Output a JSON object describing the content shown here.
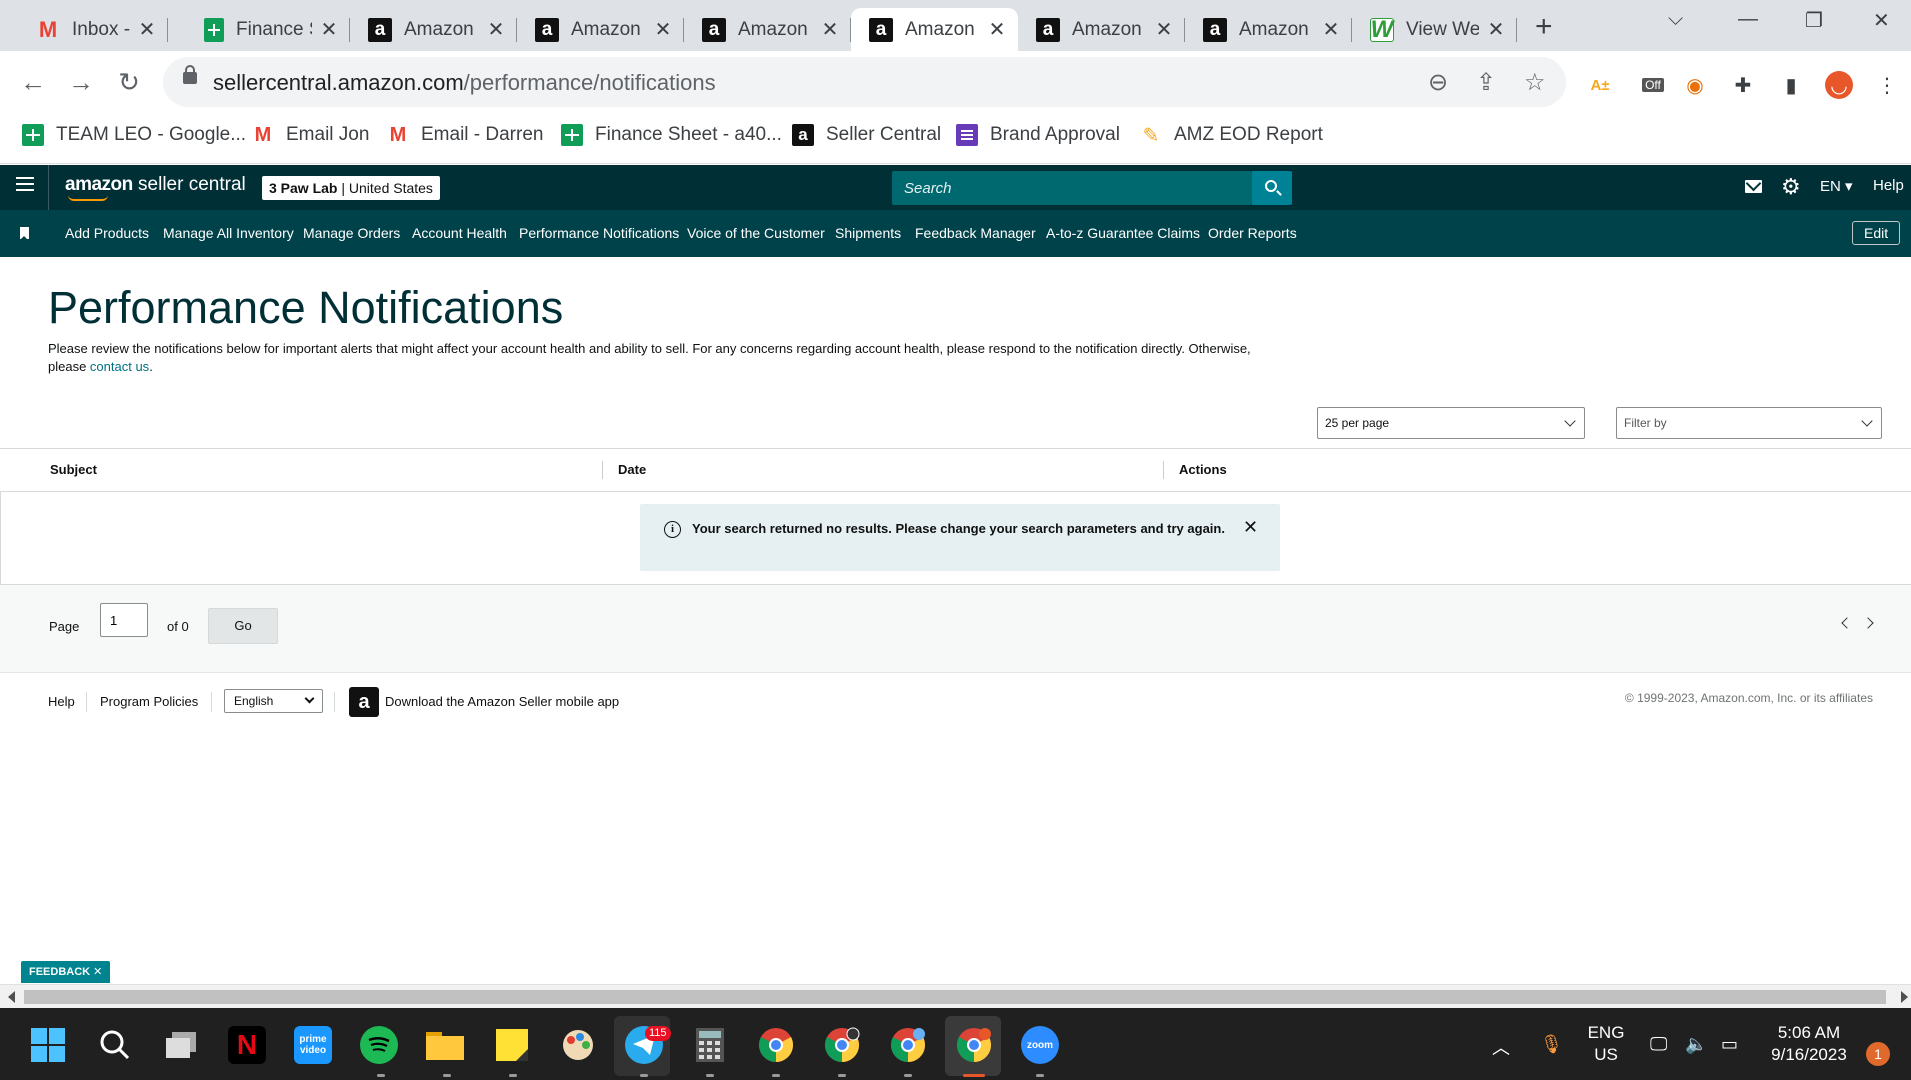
{
  "browser": {
    "tabs": [
      {
        "title": "Inbox - d",
        "favicon": "gmail-icon"
      },
      {
        "title": "Finance S",
        "favicon": "sheets-icon"
      },
      {
        "title": "Amazon",
        "favicon": "amazon-icon"
      },
      {
        "title": "Amazon",
        "favicon": "amazon-icon"
      },
      {
        "title": "Amazon",
        "favicon": "amazon-icon"
      },
      {
        "title": "Amazon",
        "favicon": "amazon-icon",
        "active": true
      },
      {
        "title": "Amazon",
        "favicon": "amazon-icon"
      },
      {
        "title": "Amazon",
        "favicon": "amazon-icon"
      },
      {
        "title": "View We",
        "favicon": "w-icon"
      }
    ],
    "close_glyph": "✕",
    "url_host": "sellercentral.amazon.com",
    "url_path": "/performance/notifications",
    "extensions": {
      "scout_label": "A±",
      "off_badge": "Off"
    },
    "bookmarks": [
      {
        "label": "TEAM LEO - Google...",
        "icon": "sheets-icon"
      },
      {
        "label": "Email Jon",
        "icon": "gmail-icon"
      },
      {
        "label": "Email - Darren",
        "icon": "gmail-icon"
      },
      {
        "label": "Finance Sheet - a40...",
        "icon": "sheets-icon"
      },
      {
        "label": "Seller Central",
        "icon": "amazon-icon"
      },
      {
        "label": "Brand Approval",
        "icon": "forms-icon"
      },
      {
        "label": "AMZ EOD Report",
        "icon": "eod-icon"
      }
    ]
  },
  "header": {
    "logo_bold": "amazon",
    "logo_rest": " seller central",
    "store_name": "3 Paw Lab",
    "store_region": " | United States",
    "search_placeholder": "Search",
    "language": "EN ▾",
    "help": "Help"
  },
  "nav": {
    "links": [
      "Add Products",
      "Manage All Inventory",
      "Manage Orders",
      "Account Health",
      "Performance Notifications",
      "Voice of the Customer",
      "Shipments",
      "Feedback Manager",
      "A-to-z Guarantee Claims",
      "Order Reports"
    ],
    "edit": "Edit"
  },
  "page": {
    "title": "Performance Notifications",
    "intro_text": "Please review the notifications below for important alerts that might affect your account health and ability to sell. For any concerns regarding account health, please respond to the notification directly. Otherwise, please ",
    "intro_link": "contact us",
    "intro_end": ".",
    "per_page": "25 per page",
    "filter_placeholder": "Filter by"
  },
  "table": {
    "columns": [
      "Subject",
      "Date",
      "Actions"
    ],
    "empty_message": "Your search returned no results. Please change your search parameters and try again.",
    "info_glyph": "i"
  },
  "pager": {
    "page_label": "Page",
    "page_value": "1",
    "of_label": "of 0",
    "go": "Go"
  },
  "footer": {
    "help": "Help",
    "policies": "Program Policies",
    "language": "English",
    "app_glyph": "a",
    "app_text": "Download the Amazon Seller mobile app",
    "copyright": "© 1999-2023, Amazon.com, Inc. or its affiliates"
  },
  "feedback": {
    "label": "FEEDBACK ✕"
  },
  "taskbar": {
    "netflix_glyph": "N",
    "prime_label": "prime video",
    "telegram_badge": "115",
    "zoom_label": "zoom",
    "lang_line1": "ENG",
    "lang_line2": "US",
    "time": "5:06 AM",
    "date": "9/16/2023",
    "notification_count": "1"
  },
  "colors": {
    "header_bg": "#002f36",
    "nav_bg": "#00424a",
    "search_bg": "#00686f",
    "link": "#007185",
    "alert_bg": "#e6f0f2",
    "feedback_bg": "#00848f"
  }
}
